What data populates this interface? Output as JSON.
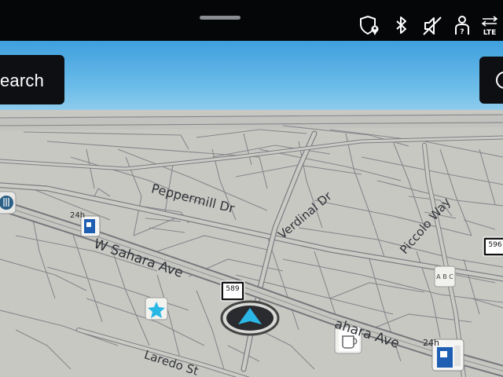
{
  "status_bar": {
    "handle": "drag-handle",
    "icons": [
      "location-privacy-icon",
      "bluetooth-icon",
      "speaker-muted-icon",
      "person-help-icon",
      "lte-signal-icon"
    ],
    "lte_label": "LTE"
  },
  "search": {
    "label": "earch"
  },
  "streets": {
    "peppermill": "Peppermill Dr",
    "verdinal": "Verdinal Dr",
    "piccolo": "Piccolo Way",
    "w_sahara": "W Sahara Ave",
    "sahara_right": "ahara Ave",
    "laredo": "Laredo St"
  },
  "route_shields": {
    "r589": "589",
    "r596": "596"
  },
  "poi_labels": {
    "h24_left": "24h",
    "h24_right": "24h",
    "abc": "A B C"
  },
  "colors": {
    "sky": "#5fb6e8",
    "ground": "#c9c9c4",
    "road": "#b4b4b0",
    "road_edge": "#84858a",
    "accent": "#2bb7e6"
  }
}
